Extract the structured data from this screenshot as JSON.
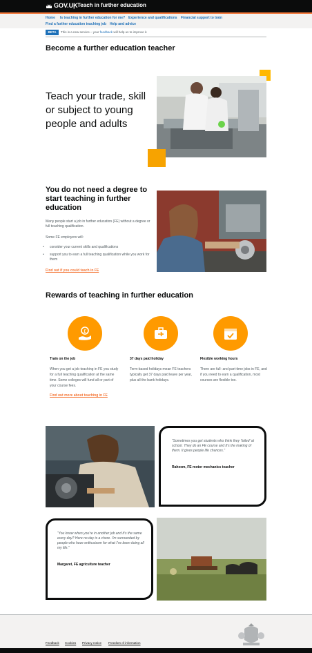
{
  "header": {
    "govuk": "GOV.UK",
    "separator": "|",
    "service": "Teach in further education"
  },
  "nav": {
    "items": [
      "Home",
      "Is teaching in further education for me?",
      "Experience and qualifications",
      "Financial support to train",
      "Find a further education teaching job",
      "Help and advice"
    ]
  },
  "beta": {
    "tag": "BETA",
    "text_before": "This is a new service – your",
    "link": "feedback",
    "text_after": "will help us to improve it."
  },
  "page_title": "Become a further education teacher",
  "hero": {
    "text": "Teach your trade, skill or subject to young people and adults"
  },
  "degree": {
    "heading": "You do not need a degree to start teaching in further education",
    "para1": "Many people start a job in further education (FE) without a degree or full teaching qualification.",
    "para2": "Some FE employers will:",
    "bullets": [
      "consider your current skills and qualifications",
      "support you to earn a full teaching qualification while you work for them"
    ],
    "link": "Find out if you could teach in FE"
  },
  "rewards": {
    "heading": "Rewards of teaching in further education",
    "items": [
      {
        "icon": "money-hand-icon",
        "title": "Train on the job",
        "desc": "When you get a job teaching in FE you study for a full teaching qualification at the same time. Some colleges will fund all or part of your course fees."
      },
      {
        "icon": "suitcase-plane-icon",
        "title": "37 days paid holiday",
        "desc": "Term-based holidays mean FE teachers typically get 37 days paid leave per year, plus all the bank holidays."
      },
      {
        "icon": "calendar-check-icon",
        "title": "Flexible working hours",
        "desc": "There are full- and part-time jobs in FE, and if you need to earn a qualification, most courses are flexible too."
      }
    ],
    "link": "Find out more about teaching in FE"
  },
  "quotes": [
    {
      "text": "“Sometimes you get students who think they ‘failed’ at school. They do an FE course and it’s the making of them. It gives people life chances.”",
      "who": "Raheem, FE motor mechanics teacher"
    },
    {
      "text": "“You know when you’re in another job and it’s the same every day? Here no day is a chore. I’m surrounded by people who have enthusiasm for what I’ve been doing all my life.”",
      "who": "Margaret, FE agriculture teacher"
    }
  ],
  "footer": {
    "links": [
      "Feedback",
      "Cookies",
      "Privacy notice",
      "Freedom of information"
    ]
  },
  "colors": {
    "header_bg": "#0b0c0c",
    "accent_orange": "#f47738",
    "link_blue": "#1d70b8",
    "icon_orange": "#ff9a00",
    "square_yellow": "#ffb800"
  }
}
